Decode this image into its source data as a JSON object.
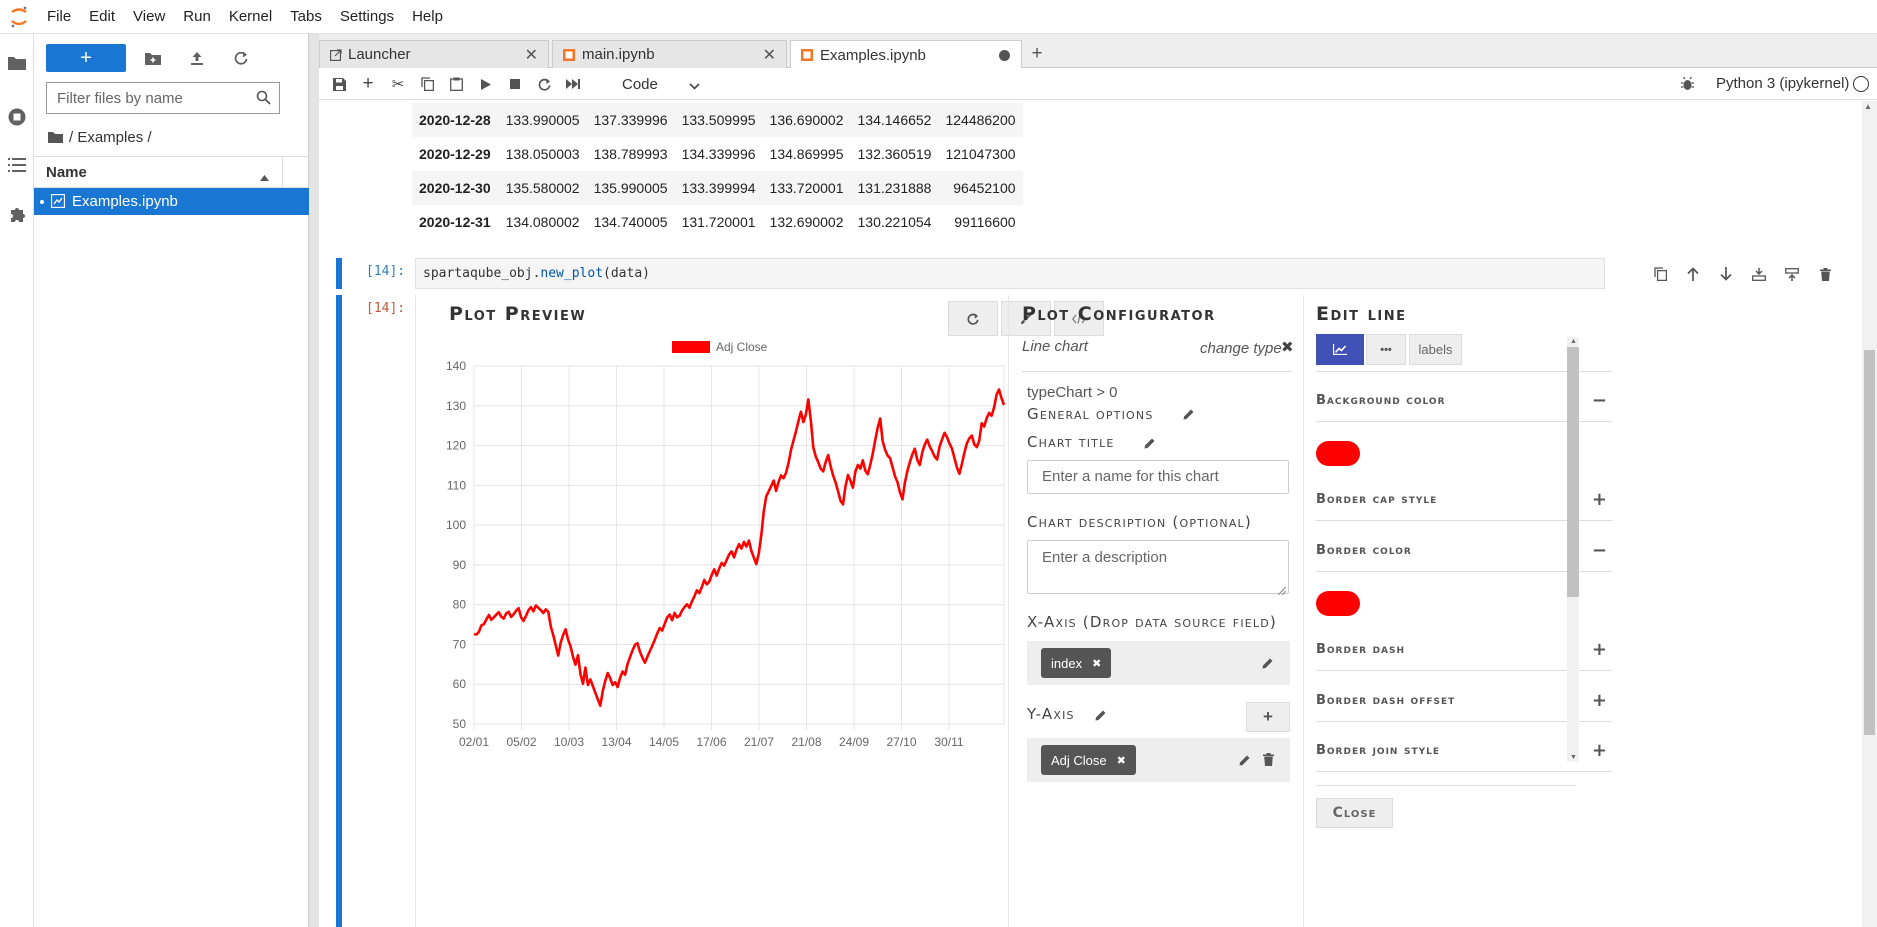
{
  "menu": [
    "File",
    "Edit",
    "View",
    "Run",
    "Kernel",
    "Tabs",
    "Settings",
    "Help"
  ],
  "filebrowser": {
    "filter_placeholder": "Filter files by name",
    "breadcrumb": "/ Examples /",
    "column_name": "Name",
    "files": [
      {
        "name": "Examples.ipynb",
        "selected": true
      }
    ]
  },
  "tabs": [
    {
      "label": "Launcher",
      "icon": "launcher-icon"
    },
    {
      "label": "main.ipynb",
      "icon": "notebook-icon"
    },
    {
      "label": "Examples.ipynb",
      "icon": "notebook-icon",
      "active": true,
      "unsaved": true
    }
  ],
  "toolbar": {
    "cell_type": "Code",
    "kernel": "Python 3 (ipykernel)"
  },
  "dataframe": {
    "rows": [
      [
        "2020-12-28",
        "133.990005",
        "137.339996",
        "133.509995",
        "136.690002",
        "134.146652",
        "124486200"
      ],
      [
        "2020-12-29",
        "138.050003",
        "138.789993",
        "134.339996",
        "134.869995",
        "132.360519",
        "121047300"
      ],
      [
        "2020-12-30",
        "135.580002",
        "135.990005",
        "133.399994",
        "133.720001",
        "131.231888",
        "96452100"
      ],
      [
        "2020-12-31",
        "134.080002",
        "134.740005",
        "131.720001",
        "132.690002",
        "130.221054",
        "99116600"
      ]
    ]
  },
  "cell": {
    "prompt_in": "[14]:",
    "prompt_out": "[14]:",
    "code_obj": "spartaqube_obj.",
    "code_fn": "new_plot",
    "code_args": "(data)"
  },
  "preview": {
    "title": "Plot Preview"
  },
  "configurator": {
    "title": "Plot Configurator",
    "chart_type": "Line chart",
    "change_type": "change type",
    "type_path": "typeChart > 0",
    "general_options": "General options",
    "chart_title_label": "Chart title",
    "chart_title_placeholder": "Enter a name for this chart",
    "description_label": "Chart description (optional)",
    "description_placeholder": "Enter a description",
    "xaxis_label": "X-Axis (Drop data source field)",
    "xaxis_chip": "index",
    "yaxis_label": "Y-Axis",
    "yaxis_chip": "Adj Close"
  },
  "edit_line": {
    "title": "Edit line",
    "tab_labels": "labels",
    "sections": [
      {
        "label": "Background color",
        "toggle": "−"
      },
      {
        "label": "Border cap style",
        "toggle": "+"
      },
      {
        "label": "Border color",
        "toggle": "−"
      },
      {
        "label": "Border dash",
        "toggle": "+"
      },
      {
        "label": "Border dash offset",
        "toggle": "+"
      },
      {
        "label": "Border join style",
        "toggle": "+"
      }
    ],
    "close": "Close",
    "line_color": "#ff0000"
  },
  "chart_data": {
    "type": "line",
    "series": [
      {
        "name": "Adj Close",
        "color": "#ff0000",
        "values": [
          72.6,
          72.5,
          73.2,
          74.8,
          75.1,
          76.3,
          77.4,
          76.2,
          76.8,
          77.5,
          78.1,
          77.0,
          76.5,
          77.8,
          78.2,
          76.9,
          77.6,
          78.5,
          79.1,
          76.8,
          75.9,
          77.2,
          78.6,
          79.4,
          78.3,
          79.8,
          79.2,
          78.6,
          77.9,
          78.8,
          78.2,
          74.5,
          72.3,
          69.8,
          67.2,
          70.5,
          72.4,
          73.8,
          71.2,
          69.5,
          66.8,
          64.9,
          67.3,
          62.5,
          60.1,
          64.2,
          59.8,
          61.2,
          59.5,
          57.8,
          56.2,
          54.6,
          58.3,
          60.9,
          62.8,
          61.5,
          59.8,
          60.5,
          59.3,
          61.6,
          63.2,
          62.4,
          65.1,
          66.8,
          68.5,
          69.9,
          70.3,
          68.2,
          66.7,
          65.4,
          66.9,
          68.3,
          69.7,
          71.2,
          72.8,
          74.1,
          73.5,
          75.2,
          76.8,
          77.5,
          76.1,
          77.9,
          76.8,
          77.2,
          78.5,
          79.4,
          80.1,
          79.2,
          80.8,
          82.1,
          83.6,
          82.9,
          84.5,
          86.2,
          85.1,
          85.8,
          87.5,
          88.9,
          87.3,
          89.1,
          90.5,
          89.8,
          91.2,
          92.6,
          93.4,
          91.9,
          93.8,
          95.2,
          94.1,
          95.8,
          94.6,
          96.1,
          93.5,
          91.8,
          90.2,
          92.9,
          97.5,
          103.5,
          107.2,
          108.5,
          109.8,
          111.2,
          108.6,
          110.9,
          112.5,
          111.8,
          113.2,
          115.6,
          118.9,
          121.3,
          123.6,
          126.1,
          128.5,
          125.9,
          127.8,
          131.6,
          126.4,
          119.5,
          117.2,
          115.8,
          114.2,
          113.5,
          115.9,
          117.6,
          114.8,
          112.5,
          110.7,
          108.5,
          106.1,
          105.2,
          109.8,
          112.6,
          111.2,
          109.4,
          113.5,
          115.1,
          114.2,
          116.3,
          113.7,
          112.8,
          115.2,
          117.9,
          121.3,
          124.5,
          126.8,
          121.2,
          118.9,
          117.5,
          116.8,
          114.5,
          112.3,
          110.8,
          108.2,
          106.5,
          110.7,
          113.6,
          115.9,
          117.8,
          119.2,
          116.4,
          115.1,
          118.3,
          120.2,
          121.5,
          119.8,
          118.6,
          117.2,
          116.5,
          119.8,
          121.6,
          123.2,
          122.1,
          120.5,
          119.2,
          116.8,
          114.5,
          112.9,
          115.4,
          118.2,
          120.6,
          121.8,
          122.5,
          120.3,
          119.6,
          121.2,
          125.6,
          124.8,
          126.9,
          128.2,
          127.5,
          129.6,
          132.8,
          134.1,
          131.9,
          130.2
        ]
      }
    ],
    "x_ticks": [
      "02/01",
      "05/02",
      "10/03",
      "13/04",
      "14/05",
      "17/06",
      "21/07",
      "21/08",
      "24/09",
      "27/10",
      "30/11"
    ],
    "y_ticks": [
      50,
      60,
      70,
      80,
      90,
      100,
      110,
      120,
      130,
      140
    ],
    "ylim": [
      50,
      140
    ],
    "legend": "top",
    "grid": true
  }
}
